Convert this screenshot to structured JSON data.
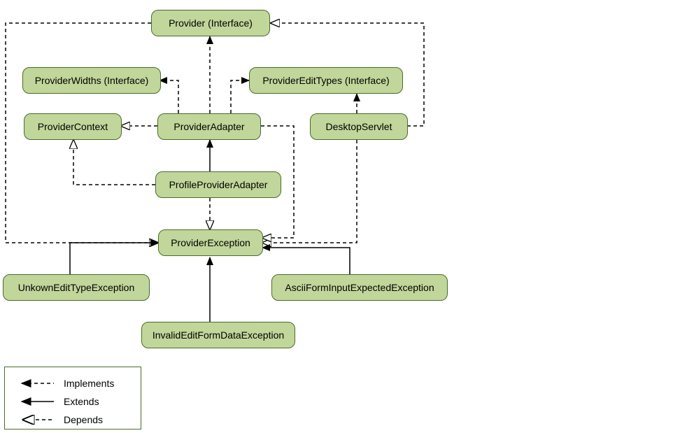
{
  "nodes": {
    "provider": "Provider (Interface)",
    "providerWidths": "ProviderWidths (Interface)",
    "providerEditTypes": "ProviderEditTypes (Interface)",
    "providerContext": "ProviderContext",
    "providerAdapter": "ProviderAdapter",
    "desktopServlet": "DesktopServlet",
    "profileProviderAdapter": "ProfileProviderAdapter",
    "providerException": "ProviderException",
    "unknownEditTypeException": "UnkownEditTypeException",
    "asciiFormInputExpectedException": "AsciiFormInputExpectedException",
    "invalidEditFormDataException": "InvalidEditFormDataException"
  },
  "legend": {
    "implements": "Implements",
    "extends": "Extends",
    "depends": "Depends"
  },
  "relationships": [
    {
      "from": "providerAdapter",
      "to": "provider",
      "type": "implements"
    },
    {
      "from": "providerAdapter",
      "to": "providerWidths",
      "type": "implements"
    },
    {
      "from": "providerAdapter",
      "to": "providerEditTypes",
      "type": "implements"
    },
    {
      "from": "desktopServlet",
      "to": "providerEditTypes",
      "type": "implements"
    },
    {
      "from": "providerAdapter",
      "to": "providerContext",
      "type": "depends"
    },
    {
      "from": "profileProviderAdapter",
      "to": "providerContext",
      "type": "depends"
    },
    {
      "from": "profileProviderAdapter",
      "to": "providerAdapter",
      "type": "extends"
    },
    {
      "from": "profileProviderAdapter",
      "to": "providerException",
      "type": "depends"
    },
    {
      "from": "provider",
      "to": "providerException",
      "type": "depends",
      "routing": "left-down"
    },
    {
      "from": "desktopServlet",
      "to": "providerException",
      "type": "depends",
      "routing": "right-down"
    },
    {
      "from": "providerAdapter",
      "to": "providerException",
      "type": "depends",
      "routing": "right-down-2"
    },
    {
      "from": "unknownEditTypeException",
      "to": "providerException",
      "type": "extends"
    },
    {
      "from": "invalidEditFormDataException",
      "to": "providerException",
      "type": "extends"
    },
    {
      "from": "asciiFormInputExpectedException",
      "to": "providerException",
      "type": "extends"
    }
  ]
}
